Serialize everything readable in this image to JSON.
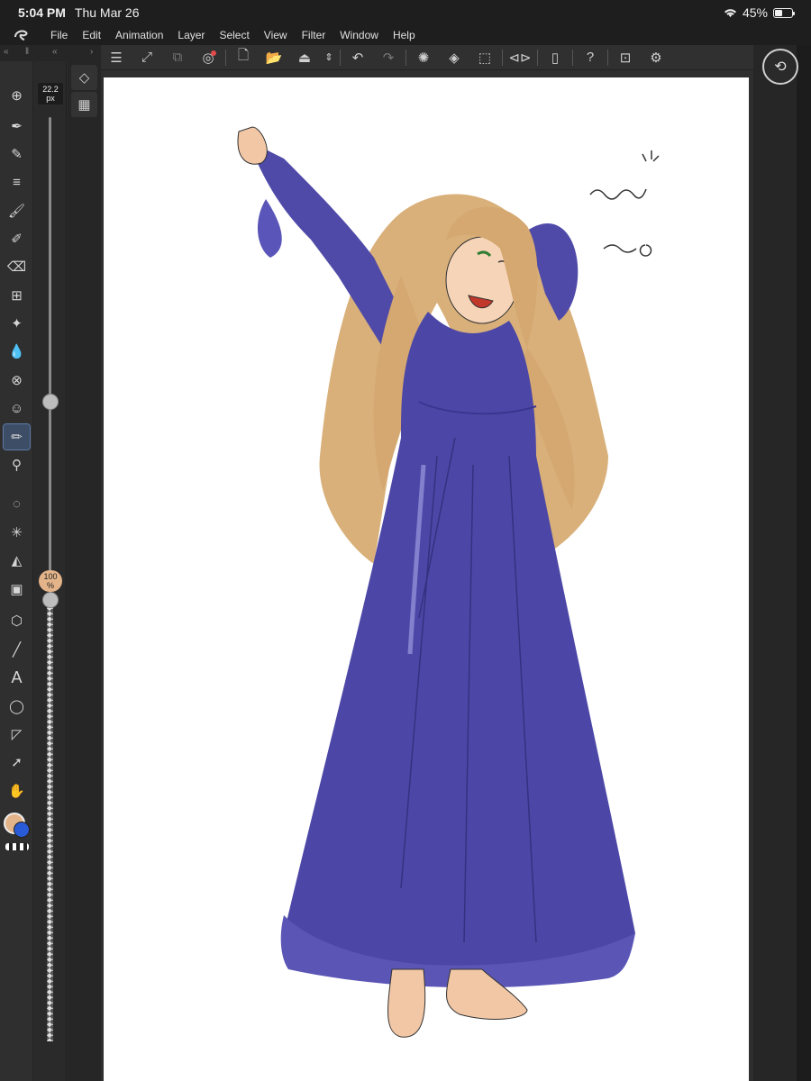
{
  "status": {
    "time": "5:04 PM",
    "date": "Thu Mar 26",
    "battery_text": "45%",
    "battery_level": 0.45,
    "wifi_icon": "wifi-icon"
  },
  "menu": {
    "items": [
      "File",
      "Edit",
      "Animation",
      "Layer",
      "Select",
      "View",
      "Filter",
      "Window",
      "Help"
    ]
  },
  "toolbar": {
    "icons": [
      "menu-icon",
      "fit-canvas-icon",
      "resize-icon",
      "record-icon",
      "new-file-icon",
      "open-file-icon",
      "save-icon",
      "more-chevron-icon",
      "undo-icon",
      "redo-icon",
      "loading-icon",
      "fill-icon",
      "transform-icon",
      "flip-icon",
      "phone-icon",
      "help-icon",
      "preview-icon",
      "settings-icon"
    ]
  },
  "brush": {
    "size_value": "22.2",
    "size_unit": "px",
    "size_level": 0.42,
    "opacity_value": "100",
    "opacity_unit": "%",
    "opacity_level": 1.0
  },
  "colors": {
    "main": "#e3b48a",
    "sub": "#2a5bd7",
    "accent": "#5c7aa8"
  },
  "tools": [
    "download-icon",
    "pen-icon",
    "pencil-icon",
    "lines-icon",
    "brush-icon",
    "airbrush-icon",
    "eraser-icon",
    "fill-brush-icon",
    "sparkle-icon",
    "blend-icon",
    "perspective-icon",
    "face-icon",
    "marker-icon",
    "eyedropper-icon",
    "lasso-icon",
    "magic-wand-icon",
    "bucket-icon",
    "gradient-icon",
    "3d-icon",
    "line-icon",
    "text-icon",
    "balloon-icon",
    "frame-icon",
    "select-arrow-icon",
    "hand-icon"
  ],
  "selected_tool": "marker-icon"
}
